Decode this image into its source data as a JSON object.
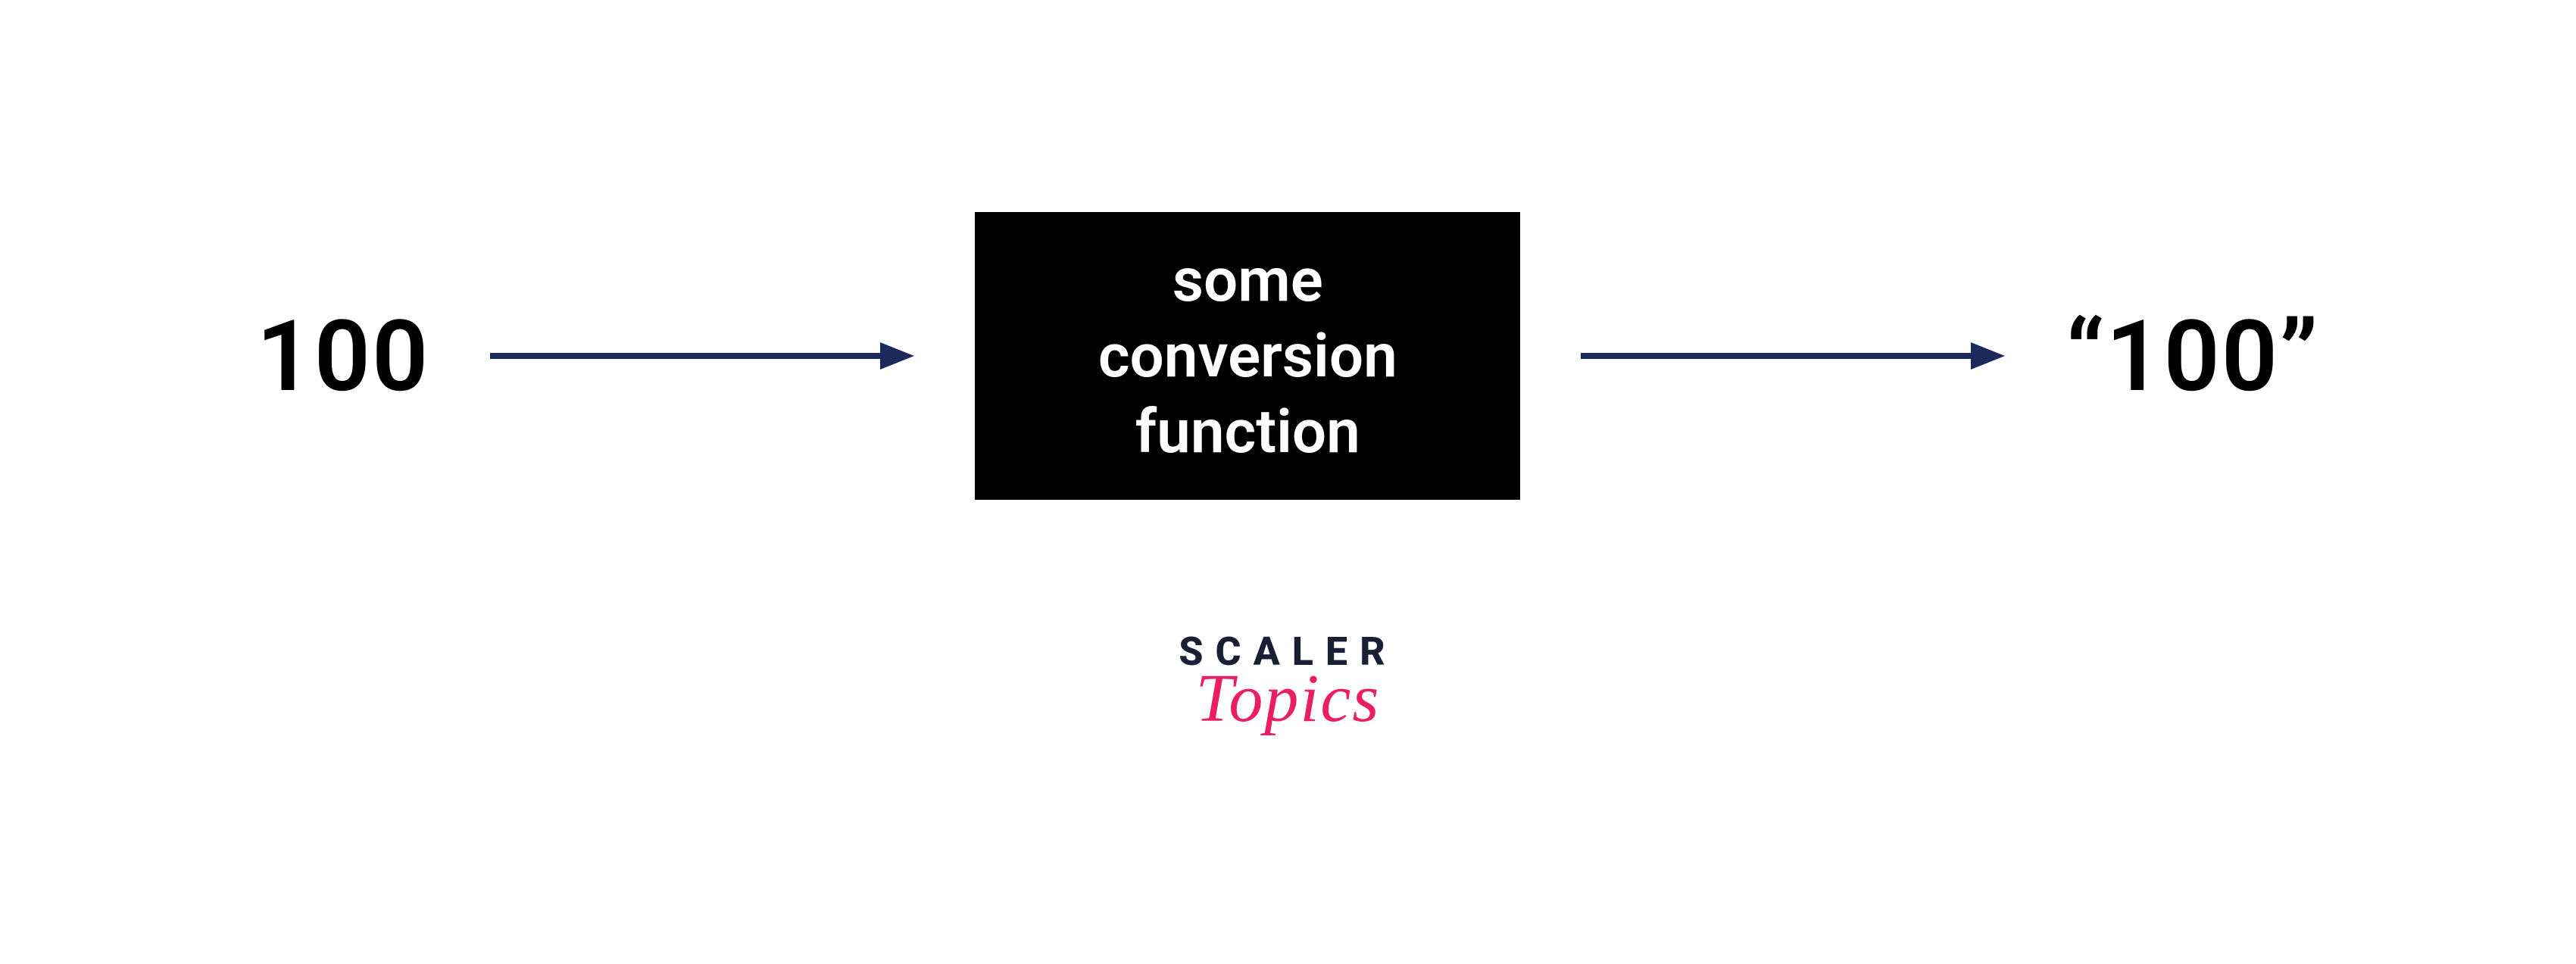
{
  "diagram": {
    "input": "100",
    "box_line1": "some",
    "box_line2": "conversion",
    "box_line3": "function",
    "output": "“100”"
  },
  "logo": {
    "line1": "SCALER",
    "line2": "Topics"
  },
  "colors": {
    "arrow": "#1a2b5c",
    "box_bg": "#000000",
    "box_text": "#ffffff",
    "logo_primary": "#1a1f36",
    "logo_accent": "#e91e63"
  }
}
